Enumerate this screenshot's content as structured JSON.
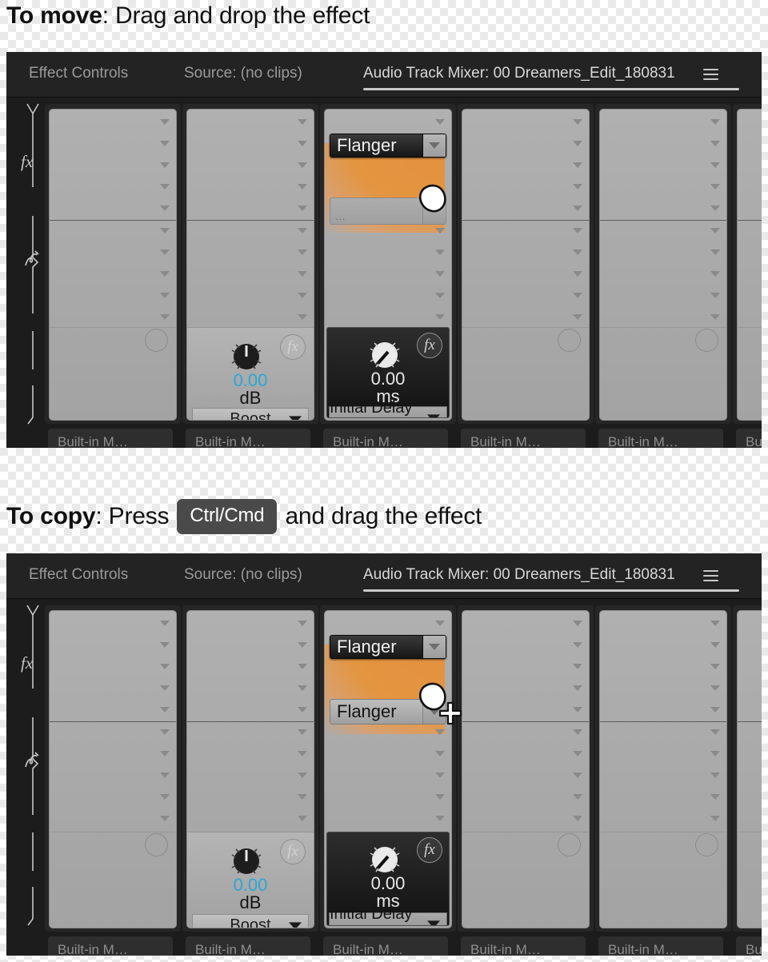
{
  "captions": {
    "move": {
      "bold": "To move",
      "rest": ": Drag and drop the effect"
    },
    "copy": {
      "bold": "To copy",
      "before": ": Press",
      "key": "Ctrl/Cmd",
      "after": "and drag the effect"
    }
  },
  "panel": {
    "tabs": [
      {
        "label": "Effect Controls",
        "active": false
      },
      {
        "label": "Source: (no clips)",
        "active": false
      },
      {
        "label": "Audio Track Mixer: 00 Dreamers_Edit_180831",
        "active": true
      }
    ],
    "menu_icon": "hamburger-icon",
    "rail": {
      "fx_label": "fx",
      "sends_label": "sends-icon"
    },
    "channels": [
      {
        "device": "Built-in M…"
      },
      {
        "device": "Built-in M…"
      },
      {
        "device": "Built-in M…"
      },
      {
        "device": "Built-in M…"
      },
      {
        "device": "Built-in M…"
      },
      {
        "device": "Bui"
      }
    ],
    "knob_light": {
      "value": "0.00",
      "unit": "dB",
      "param": "Boost",
      "fx_badge": "fx",
      "value_color": "#2aa7d8"
    },
    "knob_dark": {
      "value": "0.00",
      "unit": "ms",
      "param": "Initial Delay Time",
      "fx_badge": "fx",
      "value_color": "#e8e8e8"
    },
    "effect_name": "Flanger",
    "empty_slot_text": "…",
    "accent_orange": "#e0903e"
  },
  "move_panel": {
    "dragged_chip": "Flanger",
    "cursor": "hand-cursor"
  },
  "copy_panel": {
    "dragged_chip": "Flanger",
    "placed_chip": "Flanger",
    "cursor": "hand-cursor",
    "modifier_cursor": "plus-cursor"
  }
}
